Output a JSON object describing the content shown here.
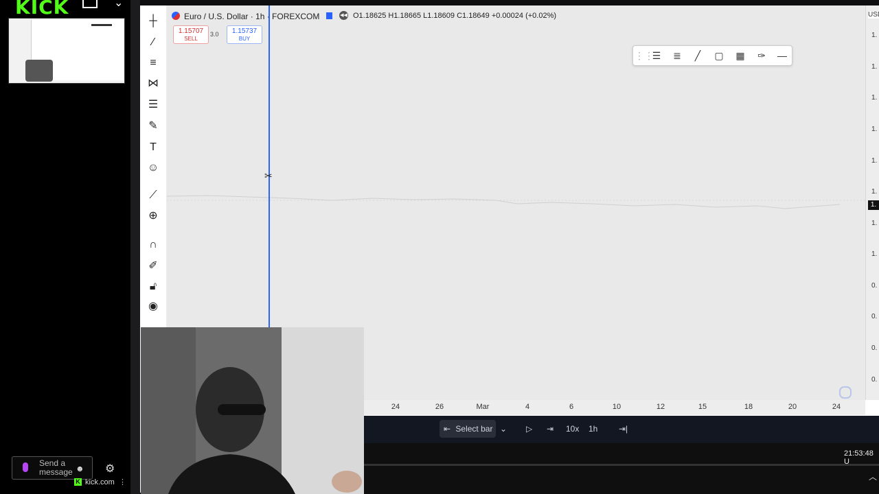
{
  "kick": {
    "logo": "KICK",
    "chat_placeholder": "Send a message",
    "footer": "kick.com",
    "colors": {
      "brand": "#53fc18"
    }
  },
  "chart": {
    "symbol_title": "Euro / U.S. Dollar · 1h · FOREXCOM",
    "ohlc": "O1.18625 H1.18665 L1.18609 C1.18649 +0.00024 (+0.02%)",
    "sell_price": "1.15707",
    "sell_label": "SELL",
    "spread": "3.0",
    "buy_price": "1.15737",
    "buy_label": "BUY",
    "currency": "USD",
    "price_ticks": [
      "1.",
      "1.",
      "1.",
      "1.",
      "1.",
      "1.",
      "1.",
      "1.",
      "0.",
      "0.",
      "0.",
      "0."
    ],
    "price_tag": "1.",
    "time_ticks": [
      "24",
      "26",
      "Mar",
      "4",
      "6",
      "10",
      "12",
      "15",
      "18",
      "20",
      "24"
    ]
  },
  "replay": {
    "select_bar": "Select bar",
    "speed": "10x",
    "interval": "1h"
  },
  "status": {
    "clock": "21:53:48 U"
  },
  "icons": {
    "left_toolbar": [
      "crosshair-icon",
      "trendline-icon",
      "horizontal-lines-icon",
      "pattern-icon",
      "fib-icon",
      "brush-icon",
      "text-icon",
      "emoji-icon",
      "ruler-icon",
      "zoom-icon",
      "magnet-icon",
      "lock-draw-icon",
      "lock-icon",
      "eye-icon"
    ],
    "drawing_toolbar": [
      "drag-handle-icon",
      "settings-lines-icon",
      "template-icon",
      "line-icon",
      "rectangle-icon",
      "grid-icon",
      "brush-icon",
      "minus-icon"
    ]
  }
}
